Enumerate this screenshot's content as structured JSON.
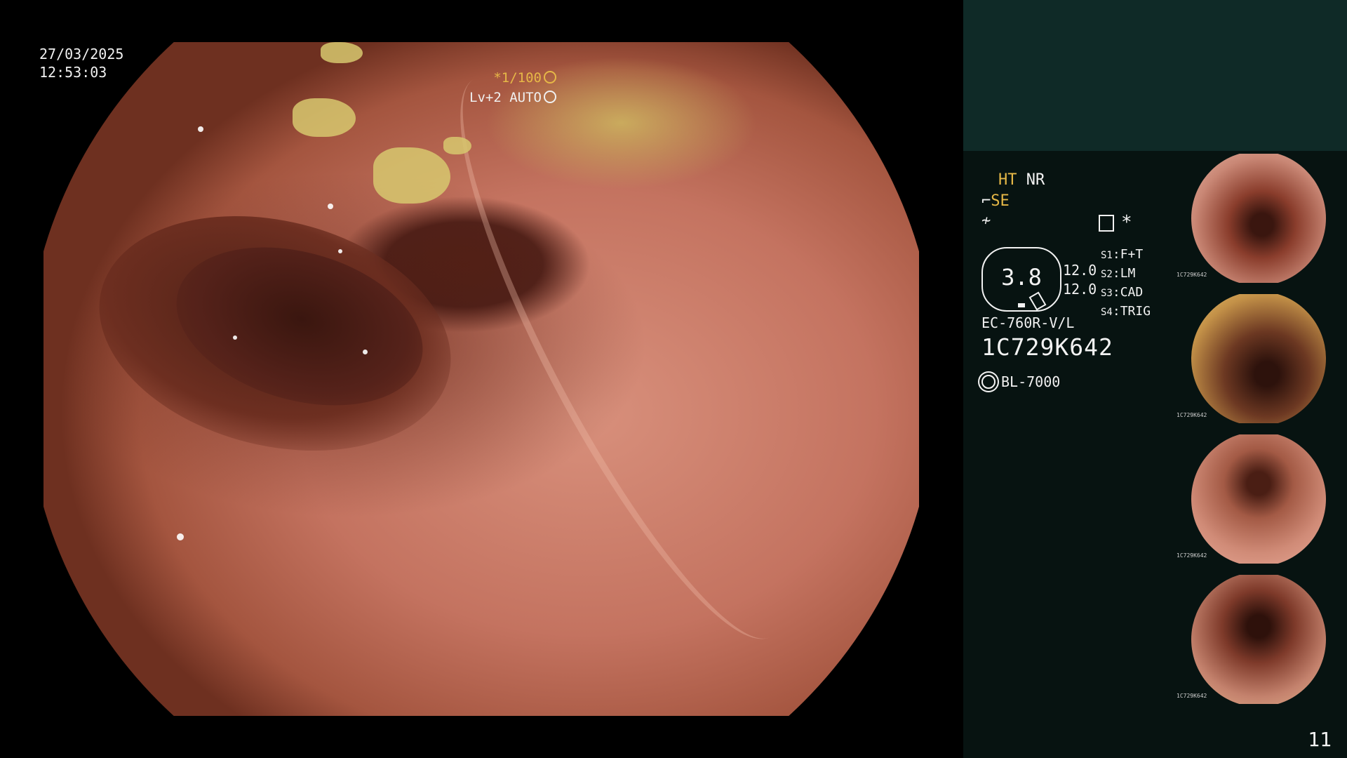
{
  "main": {
    "date": "27/03/2025",
    "time": "12:53:03",
    "shutter": "*1/100",
    "level": "Lv+2 AUTO"
  },
  "panel": {
    "mode_ht": "HT",
    "mode_nr": "NR",
    "mode_se": "SE",
    "gauge_value": "3.8",
    "gauge_numbers": [
      "12.0",
      "12.0"
    ],
    "switches": [
      {
        "key": "S1",
        "value": "F+T"
      },
      {
        "key": "S2",
        "value": "LM"
      },
      {
        "key": "S3",
        "value": "CAD"
      },
      {
        "key": "S4",
        "value": "TRIG"
      }
    ],
    "scope_model": "EC-760R-V/L",
    "serial": "1C729K642",
    "light_source": "BL-7000",
    "page_number": "11",
    "colors": {
      "accent": "#e6b847",
      "panel_bg": "#071311",
      "panel_header": "#0f2a27"
    }
  },
  "thumbnails": [
    {
      "serial": "1C729K642"
    },
    {
      "serial": "1C729K642"
    },
    {
      "serial": "1C729K642"
    },
    {
      "serial": "1C729K642"
    }
  ]
}
